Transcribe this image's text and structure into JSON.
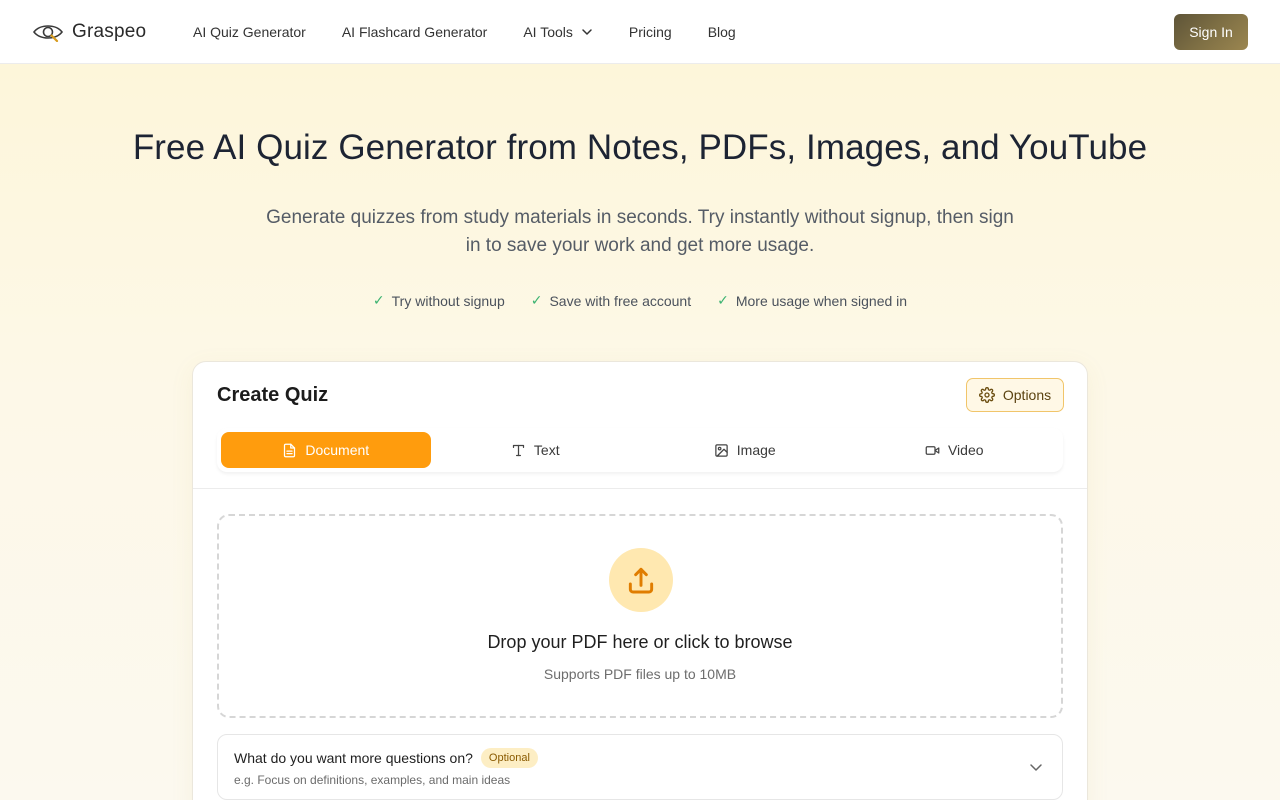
{
  "header": {
    "logo_text": "Graspeo",
    "nav": [
      {
        "label": "AI Quiz Generator"
      },
      {
        "label": "AI Flashcard Generator"
      },
      {
        "label": "AI Tools"
      },
      {
        "label": "Pricing"
      },
      {
        "label": "Blog"
      }
    ],
    "signin_label": "Sign In"
  },
  "hero": {
    "title": "Free AI Quiz Generator from Notes, PDFs, Images, and YouTube",
    "subtitle": "Generate quizzes from study materials in seconds. Try instantly without signup, then sign in to save your work and get more usage.",
    "checks": [
      {
        "label": "Try without signup"
      },
      {
        "label": "Save with free account"
      },
      {
        "label": "More usage when signed in"
      }
    ]
  },
  "card": {
    "title": "Create Quiz",
    "options_label": "Options",
    "tabs": [
      {
        "label": "Document",
        "icon": "document-icon",
        "active": true
      },
      {
        "label": "Text",
        "icon": "text-icon",
        "active": false
      },
      {
        "label": "Image",
        "icon": "image-icon",
        "active": false
      },
      {
        "label": "Video",
        "icon": "video-icon",
        "active": false
      }
    ],
    "dropzone": {
      "main": "Drop your PDF here or click to browse",
      "sub": "Supports PDF files up to 10MB"
    },
    "focus": {
      "question": "What do you want more questions on?",
      "badge": "Optional",
      "hint": "e.g. Focus on definitions, examples, and main ideas"
    }
  },
  "colors": {
    "accent": "#ff9c0d",
    "signin_bg": "#7e6f44",
    "check": "#3cb371"
  }
}
